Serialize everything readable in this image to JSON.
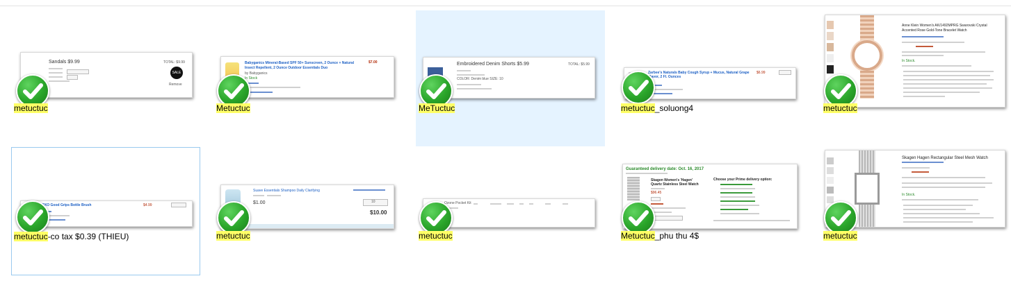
{
  "files": [
    {
      "name_highlight": "metuctuc",
      "name_rest": "",
      "check_icon": "green-checkmark-icon",
      "thumb": {
        "title": "Sandals $9.99",
        "price_total": "TOTAL: $9.99",
        "badge": "SALE",
        "action": "Remove"
      }
    },
    {
      "name_highlight": "Metuctuc",
      "name_rest": "",
      "check_icon": "green-checkmark-icon",
      "thumb": {
        "title": "Babyganics Mineral-Based SPF 50+ Sunscreen, 2 Ounce + Natural Insect Repellent, 2 Ounce Outdoor Essentials Duo",
        "brand": "by Babyganics",
        "stock": "In Stock",
        "price": "$7.00"
      }
    },
    {
      "name_highlight": "MeTuctuc",
      "name_rest": "",
      "check_icon": "green-checkmark-icon",
      "thumb": {
        "title": "Embroidered Denim Shorts $5.99",
        "total": "TOTAL: $5.99",
        "details": "COLOR: Denim blue  SIZE: 10"
      }
    },
    {
      "name_highlight": "metuctuc",
      "name_rest": "_soluong4",
      "check_icon": "green-checkmark-icon",
      "thumb": {
        "title": "Zarbee's Naturals Baby Cough Syrup + Mucus, Natural Grape Flavor, 2 Fl. Ounces",
        "price": "$6.99"
      }
    },
    {
      "name_highlight": "metuctuc",
      "name_rest": "",
      "check_icon": "green-checkmark-icon",
      "thumb": {
        "title": "Anne Klein Women's AK/1492MPRG Swarovski Crystal Accented Rose Gold-Tone Bracelet Watch",
        "stock": "In Stock."
      }
    },
    {
      "name_highlight": "metuctuc",
      "name_rest": "-co tax $0.39 (THIEU)",
      "check_icon": "green-checkmark-icon",
      "thumb": {
        "title": "OXO Good Grips Bottle Brush",
        "price": "$4.99"
      }
    },
    {
      "name_highlight": "metuctuc",
      "name_rest": "",
      "check_icon": "green-checkmark-icon",
      "thumb": {
        "title": "Suave Essentials Shampoo Daily Clarifying",
        "price": "$1.00",
        "qty": "10",
        "total": "$10.00"
      }
    },
    {
      "name_highlight": "metuctuc",
      "name_rest": "",
      "check_icon": "green-checkmark-icon",
      "thumb": {
        "title": "Ozone Pocket Kit"
      }
    },
    {
      "name_highlight": "Metuctuc",
      "name_rest": "_phu thu 4$",
      "check_icon": "green-checkmark-icon",
      "thumb": {
        "title": "Guaranteed delivery date: Oct. 16, 2017",
        "product": "Skagen Women's 'Hagen' Quartz Stainless Steel Watch",
        "price": "$96.45",
        "delivery": "Choose your Prime delivery option:"
      }
    },
    {
      "name_highlight": "metuctuc",
      "name_rest": "",
      "check_icon": "green-checkmark-icon",
      "thumb": {
        "title": "Skagen Hagen Rectangular Steel Mesh Watch",
        "stock": "In Stock."
      }
    }
  ]
}
